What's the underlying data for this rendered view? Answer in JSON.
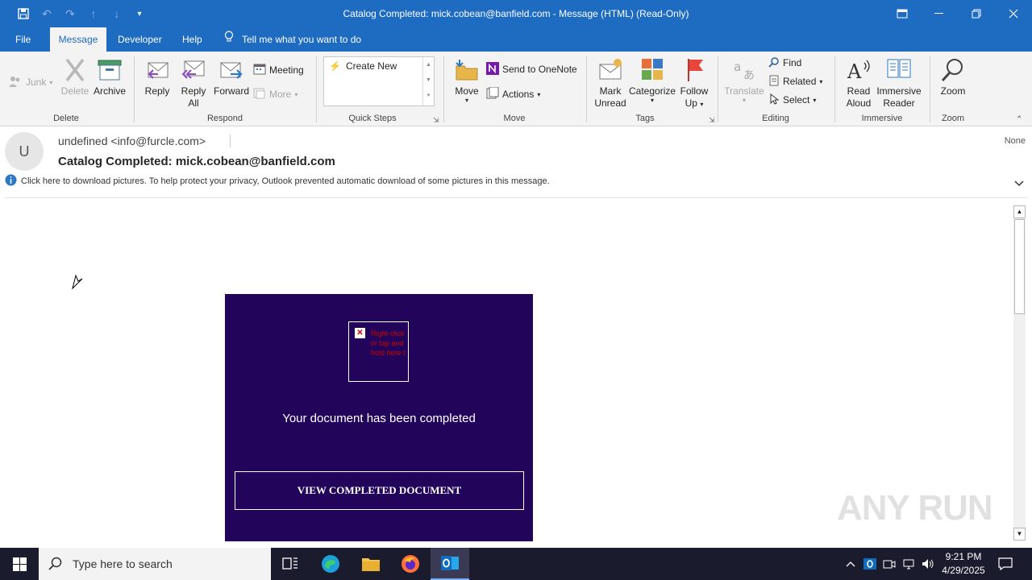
{
  "window": {
    "title": "Catalog Completed: mick.cobean@banfield.com  -  Message (HTML) (Read-Only)"
  },
  "menu": {
    "tabs": [
      "File",
      "Message",
      "Developer",
      "Help"
    ],
    "active_tab": "Message",
    "tell_me": "Tell me what you want to do"
  },
  "ribbon": {
    "delete_group": {
      "label": "Delete",
      "junk": "Junk",
      "delete": "Delete",
      "archive": "Archive"
    },
    "respond_group": {
      "label": "Respond",
      "reply": "Reply",
      "reply_all_1": "Reply",
      "reply_all_2": "All",
      "forward": "Forward",
      "meeting": "Meeting",
      "more": "More"
    },
    "quick_steps_group": {
      "label": "Quick Steps",
      "create_new": "Create New"
    },
    "move_group": {
      "label": "Move",
      "move": "Move",
      "send_to_onenote": "Send to OneNote",
      "actions": "Actions"
    },
    "tags_group": {
      "label": "Tags",
      "mark_1": "Mark",
      "mark_2": "Unread",
      "categorize": "Categorize",
      "follow_1": "Follow",
      "follow_2": "Up"
    },
    "editing_group": {
      "label": "Editing",
      "translate": "Translate",
      "find": "Find",
      "related": "Related",
      "select": "Select"
    },
    "immersive_group": {
      "label": "Immersive",
      "read_1": "Read",
      "read_2": "Aloud",
      "reader_1": "Immersive",
      "reader_2": "Reader"
    },
    "zoom_group": {
      "label": "Zoom",
      "zoom": "Zoom"
    }
  },
  "message": {
    "avatar_initial": "U",
    "sender": "undefined <info@furcle.com>",
    "subject": "Catalog Completed: mick.cobean@banfield.com",
    "importance": "None",
    "info_bar": "Click here to download pictures. To help protect your privacy, Outlook prevented automatic download of some pictures in this message."
  },
  "email_body": {
    "broken_image_text": "Right-click or tap and hold here t",
    "document_text": "Your document has been completed",
    "button_label": "VIEW COMPLETED DOCUMENT"
  },
  "watermark": "ANY RUN",
  "taskbar": {
    "search_placeholder": "Type here to search",
    "time": "9:21 PM",
    "date": "4/29/2025"
  },
  "colors": {
    "titlebar": "#1e6bc2",
    "email_panel": "#22055a",
    "taskbar": "#1b1b2e"
  }
}
